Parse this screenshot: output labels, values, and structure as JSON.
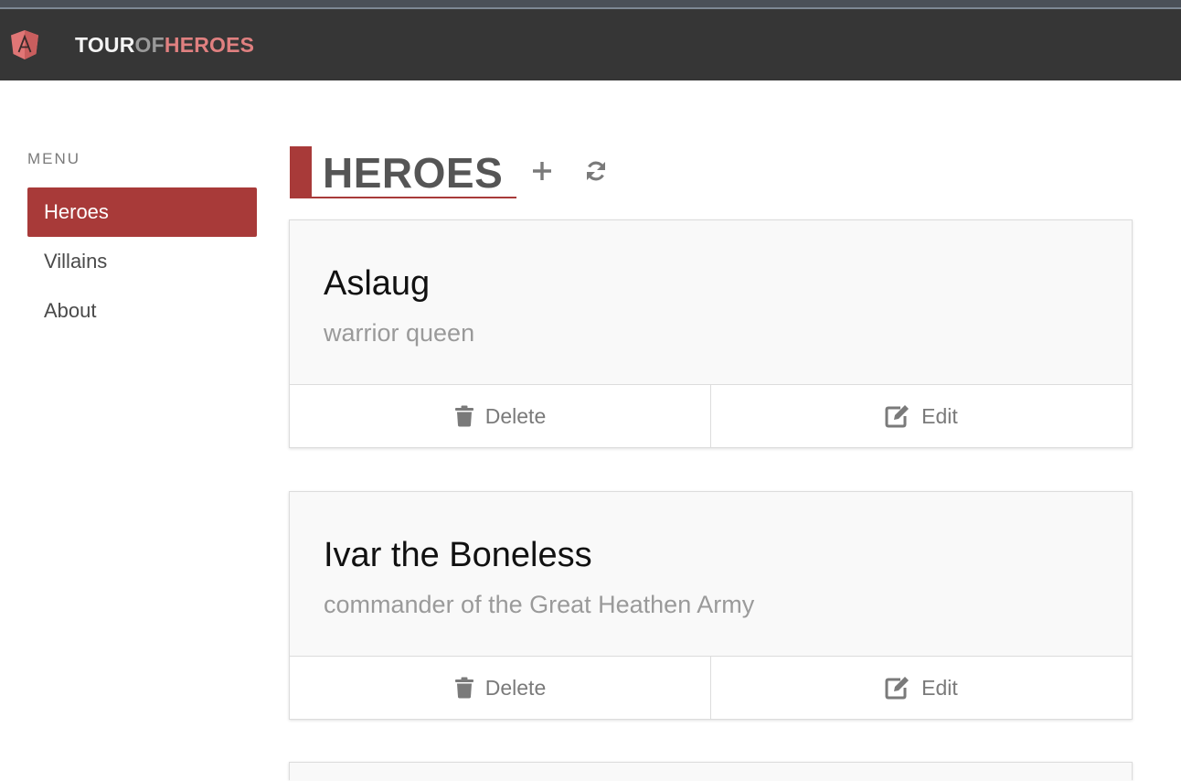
{
  "app": {
    "brand_tour": "TOUR",
    "brand_of": "OF",
    "brand_heroes": "HEROES",
    "logo_letter": "A"
  },
  "sidebar": {
    "label": "MENU",
    "items": [
      {
        "label": "Heroes",
        "active": true
      },
      {
        "label": "Villains",
        "active": false
      },
      {
        "label": "About",
        "active": false
      }
    ]
  },
  "main": {
    "title": "HEROES",
    "add_icon": "plus-icon",
    "refresh_icon": "refresh-icon",
    "heroes": [
      {
        "name": "Aslaug",
        "description": "warrior queen",
        "delete_label": "Delete",
        "edit_label": "Edit"
      },
      {
        "name": "Ivar the Boneless",
        "description": "commander of the Great Heathen Army",
        "delete_label": "Delete",
        "edit_label": "Edit"
      }
    ]
  },
  "colors": {
    "accent": "#a83a39",
    "navbar": "#363636",
    "brand_heroes": "#e08080"
  }
}
